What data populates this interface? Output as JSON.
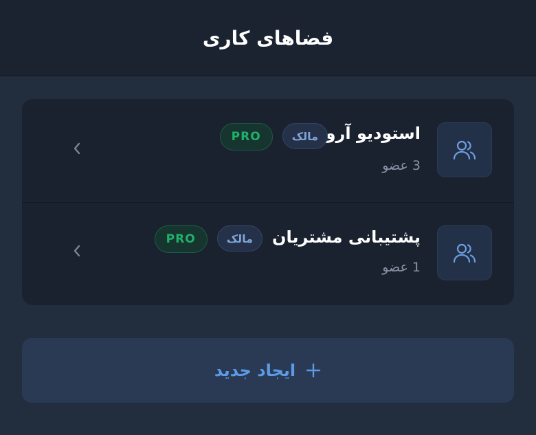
{
  "header": {
    "title": "فضاهای کاری"
  },
  "workspaces": [
    {
      "name": "استودیو آرورا",
      "members": "3 عضو",
      "owner_badge": "مالک",
      "plan_badge": "PRO",
      "icon": "users-icon"
    },
    {
      "name": "پشتیبانی مشتریان",
      "members": "1 عضو",
      "owner_badge": "مالک",
      "plan_badge": "PRO",
      "icon": "users-icon"
    }
  ],
  "create_button": {
    "label": "ایجاد جدید",
    "icon": "plus-icon"
  },
  "colors": {
    "background": "#222d3d",
    "header_bg": "#1b2330",
    "card_bg": "#1a2230",
    "accent": "#5b9be6",
    "pro_green": "#1fb16b"
  }
}
